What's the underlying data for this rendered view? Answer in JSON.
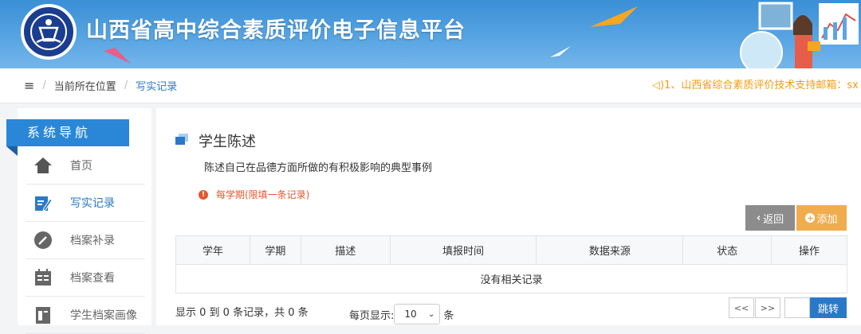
{
  "header": {
    "title": "山西省高中综合素质评价电子信息平台",
    "logo_icon": "school-logo-icon"
  },
  "breadcrumb": {
    "menu_icon": "≡",
    "location_label": "当前所在位置",
    "current": "写实记录",
    "notice": "1、山西省综合素质评价技术支持邮箱：sx"
  },
  "sidebar": {
    "title": "系统导航",
    "items": [
      {
        "label": "首页",
        "icon": "home-icon"
      },
      {
        "label": "写实记录",
        "icon": "edit-icon"
      },
      {
        "label": "档案补录",
        "icon": "pencil-icon"
      },
      {
        "label": "档案查看",
        "icon": "calendar-icon"
      },
      {
        "label": "学生档案画像",
        "icon": "document-icon"
      }
    ]
  },
  "main": {
    "section_title": "学生陈述",
    "description": "陈述自己在品德方面所做的有积极影响的典型事例",
    "warning": "每学期(限填一条记录)",
    "back_button": "返回",
    "add_button": "添加",
    "table": {
      "headers": [
        "学年",
        "学期",
        "描述",
        "填报时间",
        "数据来源",
        "状态",
        "操作"
      ],
      "empty_text": "没有相关记录"
    },
    "pagination": {
      "info": "显示 0 到 0 条记录，共 0 条",
      "page_size_label": "每页显示:",
      "page_size": "10",
      "page_size_unit": "条",
      "prev": "<<",
      "next": ">>",
      "go_button": "跳转"
    }
  },
  "colors": {
    "accent": "#2a79c8",
    "warning": "#e4572e",
    "notice": "#f39c12",
    "add_button": "#f0ad4e",
    "back_button": "#8c8c8c"
  }
}
